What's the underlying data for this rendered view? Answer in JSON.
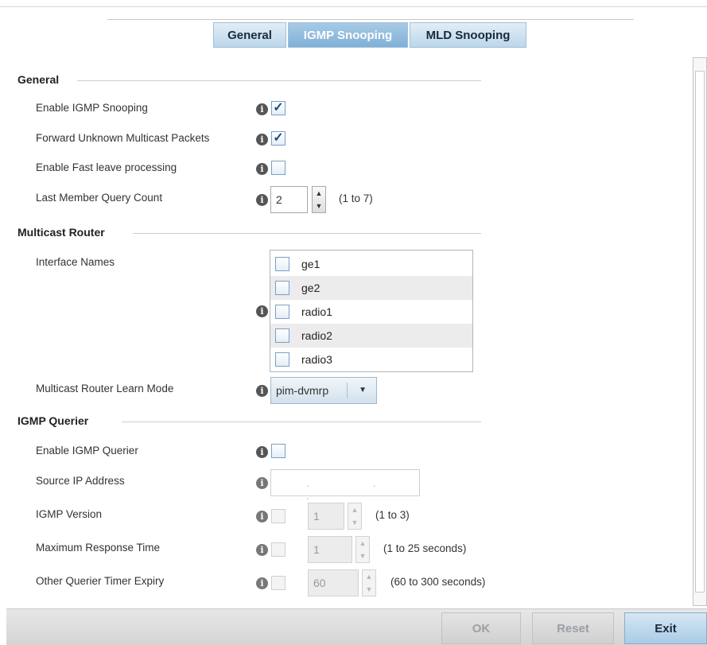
{
  "tabs": [
    {
      "label": "General",
      "active": false
    },
    {
      "label": "IGMP Snooping",
      "active": true
    },
    {
      "label": "MLD Snooping",
      "active": false
    }
  ],
  "general": {
    "title": "General",
    "enable_igmp_snooping": {
      "label": "Enable IGMP Snooping",
      "checked": true
    },
    "forward_unknown": {
      "label": "Forward Unknown Multicast Packets",
      "checked": true
    },
    "fast_leave": {
      "label": "Enable Fast leave processing",
      "checked": false
    },
    "last_member_query_count": {
      "label": "Last Member Query Count",
      "value": "2",
      "hint": "(1 to 7)"
    }
  },
  "multicast_router": {
    "title": "Multicast Router",
    "interface_names_label": "Interface Names",
    "interfaces": [
      "ge1",
      "ge2",
      "radio1",
      "radio2",
      "radio3"
    ],
    "learn_mode": {
      "label": "Multicast Router Learn Mode",
      "value": "pim-dvmrp"
    }
  },
  "igmp_querier": {
    "title": "IGMP Querier",
    "enable": {
      "label": "Enable IGMP Querier",
      "checked": false
    },
    "source_ip": {
      "label": "Source IP Address",
      "value": ". . ."
    },
    "version": {
      "label": "IGMP Version",
      "value": "1",
      "hint": "(1 to 3)"
    },
    "max_response": {
      "label": "Maximum Response Time",
      "value": "1",
      "hint": "(1 to 25 seconds)"
    },
    "other_querier": {
      "label": "Other Querier Timer Expiry",
      "value": "60",
      "hint": "(60 to 300 seconds)"
    }
  },
  "footer": {
    "ok": "OK",
    "reset": "Reset",
    "exit": "Exit"
  },
  "icons": {
    "info": "i",
    "check": "✓",
    "up": "▲",
    "down": "▼"
  }
}
